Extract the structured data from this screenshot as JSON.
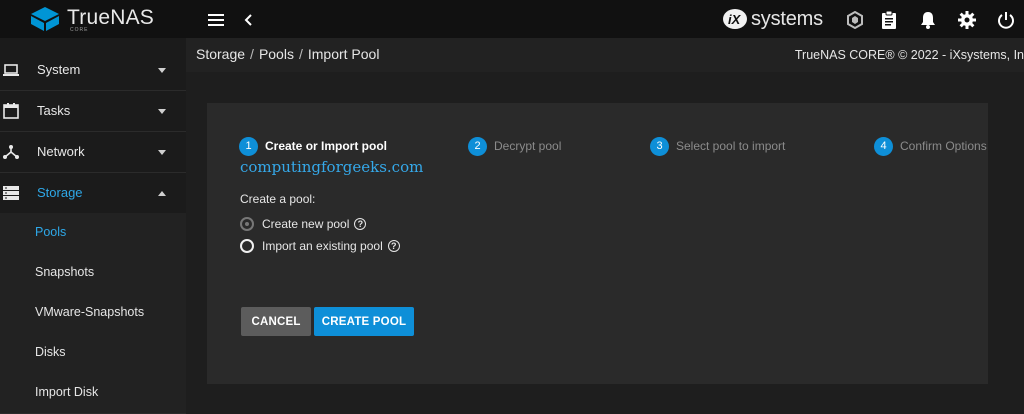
{
  "app": {
    "logo_text": "TrueNAS",
    "logo_sub": "CORE",
    "vendor_text": "systems"
  },
  "topbar": {
    "icons": [
      "menu-icon",
      "back-chevron-icon",
      "truecommand-icon",
      "clipboard-icon",
      "bell-icon",
      "gear-icon",
      "power-icon"
    ]
  },
  "sidebar": {
    "items": [
      {
        "label": "System",
        "icon": "laptop-icon",
        "expanded": false
      },
      {
        "label": "Tasks",
        "icon": "calendar-icon",
        "expanded": false
      },
      {
        "label": "Network",
        "icon": "network-icon",
        "expanded": false
      },
      {
        "label": "Storage",
        "icon": "storage-icon",
        "expanded": true
      }
    ],
    "storage_children": [
      {
        "label": "Pools",
        "active": true
      },
      {
        "label": "Snapshots",
        "active": false
      },
      {
        "label": "VMware-Snapshots",
        "active": false
      },
      {
        "label": "Disks",
        "active": false
      },
      {
        "label": "Import Disk",
        "active": false
      }
    ]
  },
  "breadcrumb": {
    "items": [
      "Storage",
      "Pools",
      "Import Pool"
    ],
    "separator": "/"
  },
  "copyright": "TrueNAS CORE® © 2022 - iXsystems, In",
  "wizard": {
    "steps": [
      {
        "number": "1",
        "label": "Create or Import pool",
        "active": true
      },
      {
        "number": "2",
        "label": "Decrypt pool",
        "active": false
      },
      {
        "number": "3",
        "label": "Select pool to import",
        "active": false
      },
      {
        "number": "4",
        "label": "Confirm Options",
        "active": false
      }
    ],
    "form_label": "Create a pool:",
    "options": [
      {
        "label": "Create new pool",
        "state": "disabled-checked"
      },
      {
        "label": "Import an existing pool",
        "state": "unchecked"
      }
    ],
    "help_glyph": "?",
    "cancel_label": "CANCEL",
    "create_label": "CREATE POOL"
  },
  "watermark": "computingforgeeks.com",
  "colors": {
    "accent": "#0e8fd8",
    "topbar": "#111111",
    "active_nav": "#2ea8e8"
  }
}
